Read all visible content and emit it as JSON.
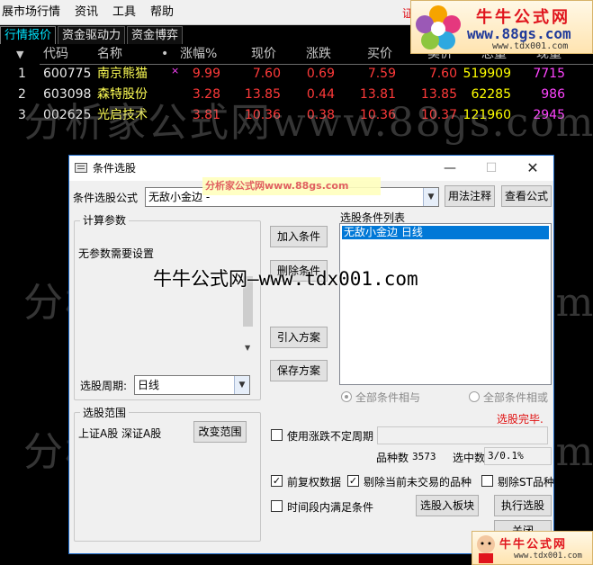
{
  "menu": [
    "展市场行情",
    "资讯",
    "工具",
    "帮助"
  ],
  "tabs": [
    "行情报价",
    "资金驱动力",
    "资金博弈"
  ],
  "colors": {
    "up": "#ff3a3a",
    "code": "#e8e8e8",
    "name": "#ffff55",
    "volume": "#ffff00",
    "now_vol": "#ff44ff",
    "header": "#c8c8c8",
    "active_tab": "#00e5ff"
  },
  "table": {
    "sort_marker": "▼",
    "headers": [
      "代码",
      "名称",
      "•",
      "涨幅%",
      "现价",
      "涨跌",
      "买价",
      "卖价",
      "总量",
      "现量"
    ],
    "rows": [
      {
        "idx": "1",
        "code": "600775",
        "name": "南京熊猫",
        "mark": "×",
        "change_pct": "9.99",
        "price": "7.60",
        "change": "0.69",
        "bid": "7.59",
        "ask": "7.60",
        "volume": "519909",
        "now_vol": "7715"
      },
      {
        "idx": "2",
        "code": "603098",
        "name": "森特股份",
        "mark": "",
        "change_pct": "3.28",
        "price": "13.85",
        "change": "0.44",
        "bid": "13.81",
        "ask": "13.85",
        "volume": "62285",
        "now_vol": "986"
      },
      {
        "idx": "3",
        "code": "002625",
        "name": "光启技术",
        "mark": "",
        "change_pct": "3.81",
        "price": "10.36",
        "change": "0.38",
        "bid": "10.36",
        "ask": "10.37",
        "volume": "121960",
        "now_vol": "2945"
      }
    ]
  },
  "watermarks": {
    "big": "分析家公式网www.88gs.com",
    "middle": "牛牛公式网—www.tdx001.com",
    "dialog_overlay": "分析家公式网www.88gs.com"
  },
  "logo": {
    "cn": "牛牛公式网",
    "site1": "www.88gs.com",
    "site2": "www.tdx001.com"
  },
  "partial_text_top": "证",
  "dialog": {
    "title": "条件选股",
    "formula_label": "条件选股公式",
    "formula_value": "无敌小金边  -",
    "usage_button": "用法注释",
    "view_button": "查看公式",
    "calc_group": "计算参数",
    "no_params": "无参数需要设置",
    "add_condition": "加入条件",
    "delete_condition": "删除条件",
    "import_plan": "引入方案",
    "save_plan": "保存方案",
    "list_title": "选股条件列表",
    "list_items": [
      "无敌小金边  日线"
    ],
    "and_radio": "全部条件相与",
    "or_radio": "全部条件相或",
    "done": "选股完毕.",
    "period_label": "选股周期:",
    "period_value": "日线",
    "range_group": "选股范围",
    "range_value": "上证A股  深证A股",
    "change_range": "改变范围",
    "use_variable_period": "使用涨跌不定周期",
    "count_label": "品种数",
    "count_value": "3573",
    "selected_label": "选中数",
    "selected_value": "3/0.1%",
    "pre_adjust": "前复权数据",
    "exclude_untraded": "剔除当前未交易的品种",
    "exclude_st": "剔除ST品种",
    "time_period": "时间段内满足条件",
    "to_board": "选股入板块",
    "execute": "执行选股",
    "close": "关闭"
  }
}
